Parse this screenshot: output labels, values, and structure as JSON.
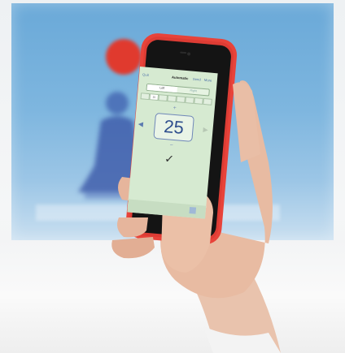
{
  "app": {
    "nav": {
      "quit_label": "Quit",
      "title": "Automatic",
      "send_label": "Send",
      "more_label": "More"
    },
    "segmented": {
      "left_label": "Left",
      "right_label": "Right"
    },
    "row_cells": [
      "",
      "15",
      "",
      "",
      "",
      "",
      "",
      ""
    ],
    "active_cell_index": 1,
    "value_display": "25",
    "plus_symbol": "+",
    "minus_symbol": "−",
    "confirm_symbol": "✓",
    "left_arrow_symbol": "◀",
    "right_arrow_symbol": "▶",
    "bottom_left_label": "",
    "colors": {
      "phone_case": "#e8433a",
      "screen_bg": "#d6ead1",
      "number_color": "#2f4f8e",
      "monitor_bg": "#7eb6df",
      "red_dot": "#e03a2e"
    }
  }
}
